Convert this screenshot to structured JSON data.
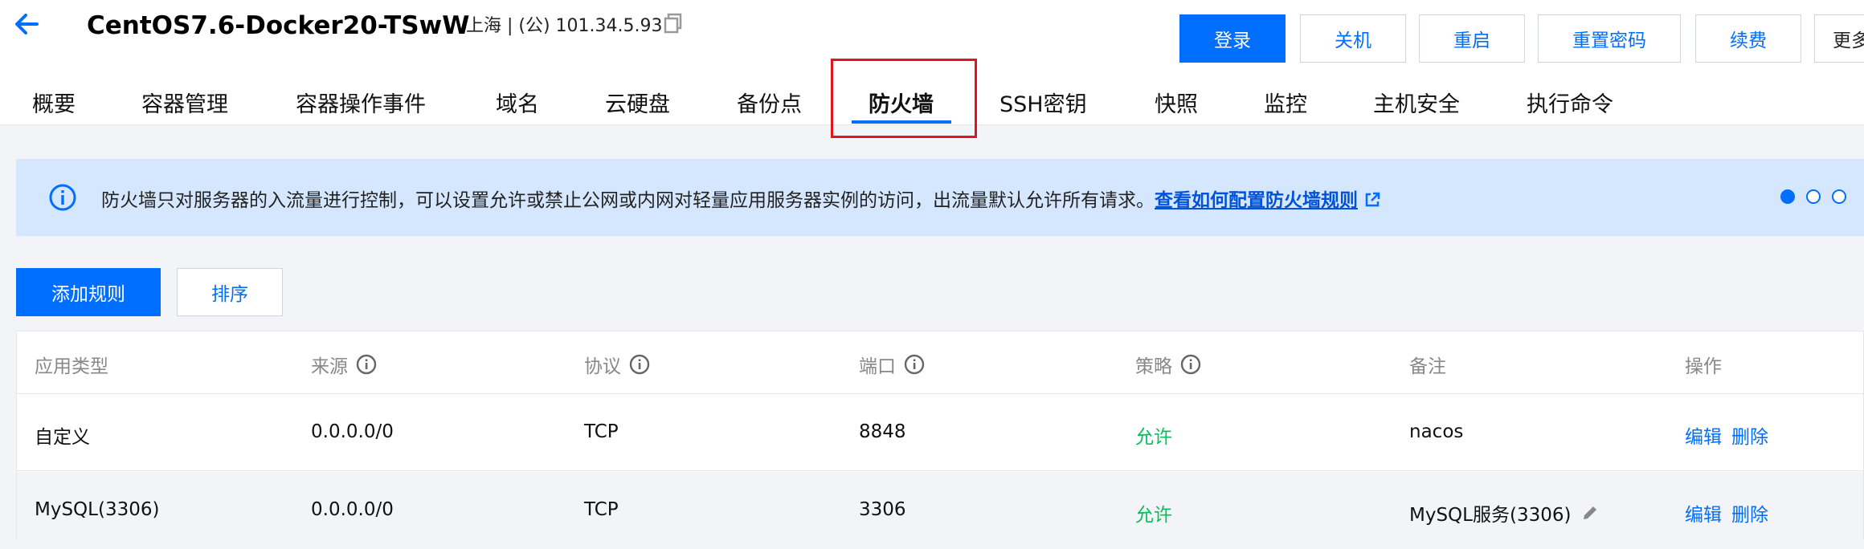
{
  "header": {
    "title": "CentOS7.6-Docker20-TSwW",
    "ip_info": "上海 | (公) 101.34.5.93",
    "buttons": {
      "login": "登录",
      "shutdown": "关机",
      "restart": "重启",
      "reset_password": "重置密码",
      "renew": "续费",
      "more": "更多"
    }
  },
  "tabs": [
    "概要",
    "容器管理",
    "容器操作事件",
    "域名",
    "云硬盘",
    "备份点",
    "防火墙",
    "SSH密钥",
    "快照",
    "监控",
    "主机安全",
    "执行命令"
  ],
  "active_tab": "防火墙",
  "notice": {
    "text": "防火墙只对服务器的入流量进行控制，可以设置允许或禁止公网或内网对轻量应用服务器实例的访问，出流量默认允许所有请求。",
    "link": "查看如何配置防火墙规则"
  },
  "actions": {
    "add_rule": "添加规则",
    "sort": "排序"
  },
  "table": {
    "columns": [
      "应用类型",
      "来源",
      "协议",
      "端口",
      "策略",
      "备注",
      "操作"
    ],
    "rows": [
      {
        "app_type": "自定义",
        "source": "0.0.0.0/0",
        "protocol": "TCP",
        "port": "8848",
        "policy": "允许",
        "remark": "nacos",
        "edit": "编辑",
        "delete": "删除"
      },
      {
        "app_type": "MySQL(3306)",
        "source": "0.0.0.0/0",
        "protocol": "TCP",
        "port": "3306",
        "policy": "允许",
        "remark": "MySQL服务(3306)",
        "edit": "编辑",
        "delete": "删除"
      }
    ]
  },
  "colors": {
    "primary": "#006eff",
    "allow": "#0abf5b",
    "highlight_box": "#e0161f",
    "notice_bg": "#d5e7fe"
  }
}
